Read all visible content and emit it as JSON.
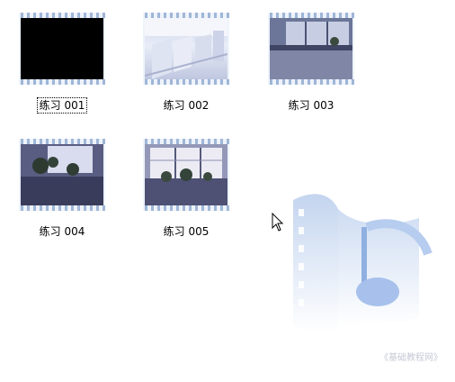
{
  "files": [
    {
      "label": "练习 001",
      "scene": "black",
      "selected": true
    },
    {
      "label": "练习 002",
      "scene": "classroom",
      "selected": false
    },
    {
      "label": "练习 003",
      "scene": "window",
      "selected": false
    },
    {
      "label": "练习 004",
      "scene": "plants-dark",
      "selected": false
    },
    {
      "label": "练习 005",
      "scene": "plants-window",
      "selected": false
    }
  ],
  "watermark": {
    "text": "《基础教程网》"
  },
  "icons": {
    "cursor": "pointer-arrow-icon",
    "logo": "film-music-note-icon"
  }
}
